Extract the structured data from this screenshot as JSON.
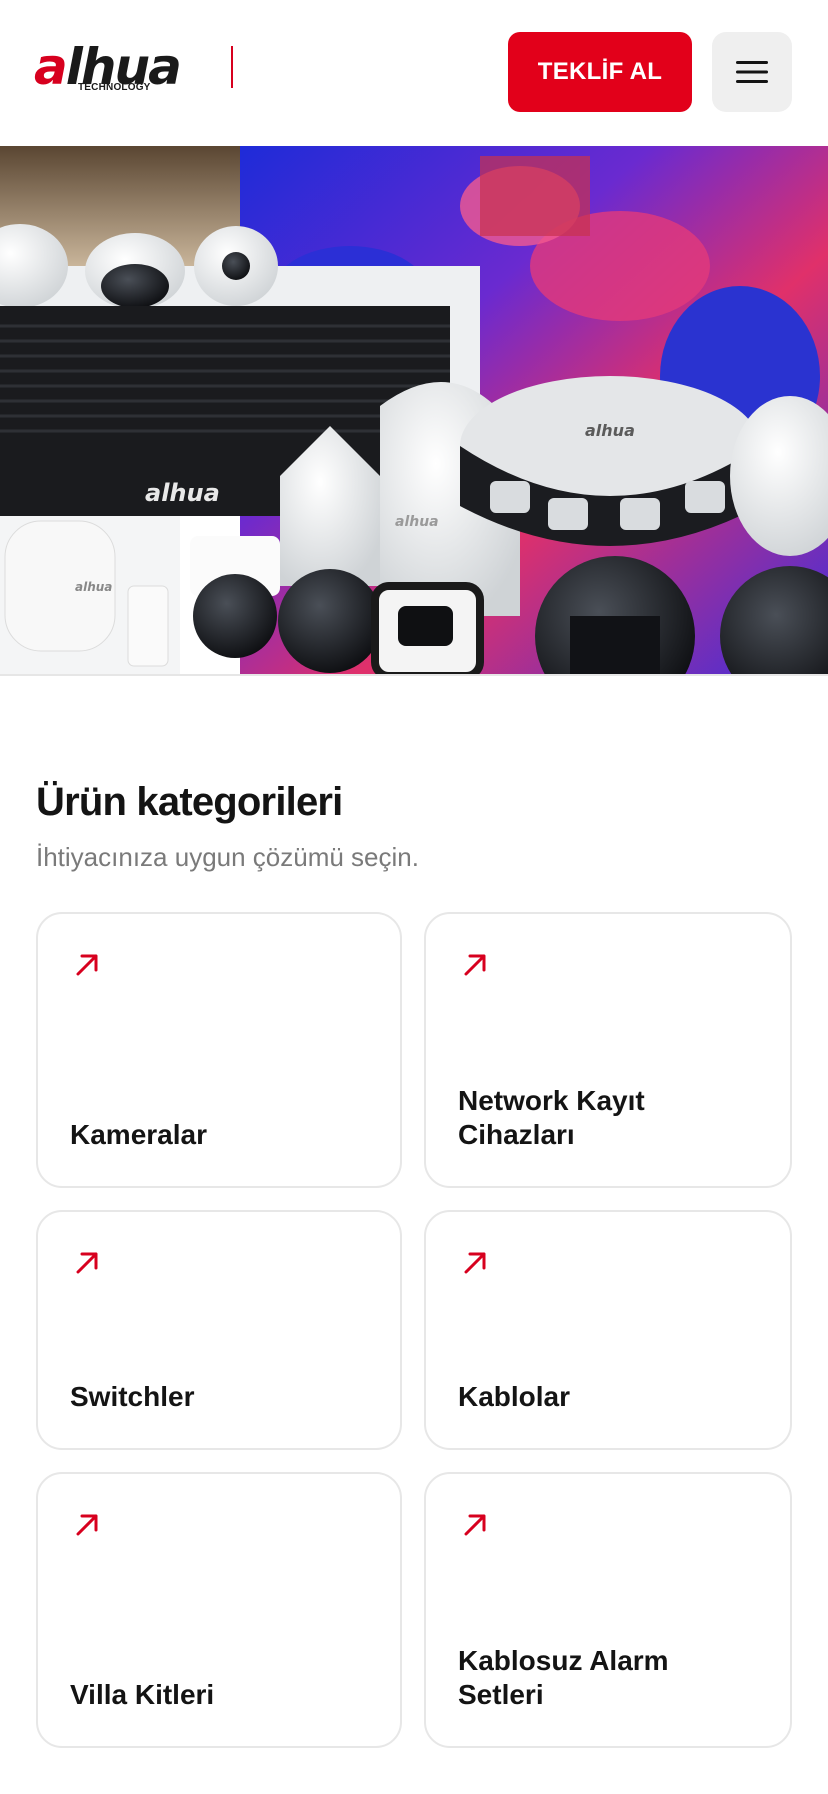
{
  "header": {
    "logo_text_a": "a",
    "logo_text_rest": "lhua",
    "logo_sub": "TECHNOLOGY",
    "cta_label": "TEKLİF AL",
    "menu_icon": "hamburger-menu-icon"
  },
  "hero": {
    "image": "security-products-banner",
    "brand_marks": [
      "alhua",
      "alhua",
      "alhua",
      "alhua"
    ]
  },
  "categories": {
    "title": "Ürün kategorileri",
    "subtitle": "İhtiyacınıza uygun çözümü seçin.",
    "items": [
      {
        "label": "Kameralar",
        "icon": "arrow-up-right-icon"
      },
      {
        "label": "Network Kayıt\nCihazları",
        "icon": "arrow-up-right-icon"
      },
      {
        "label": "Switchler",
        "icon": "arrow-up-right-icon"
      },
      {
        "label": "Kablolar",
        "icon": "arrow-up-right-icon"
      },
      {
        "label": "Villa Kitleri",
        "icon": "arrow-up-right-icon"
      },
      {
        "label": "Kablosuz Alarm\nSetleri",
        "icon": "arrow-up-right-icon"
      }
    ]
  },
  "colors": {
    "brand_red": "#e2001a",
    "text_dark": "#141414",
    "text_muted": "#7a7a7a",
    "card_border": "#e7e7e7"
  }
}
